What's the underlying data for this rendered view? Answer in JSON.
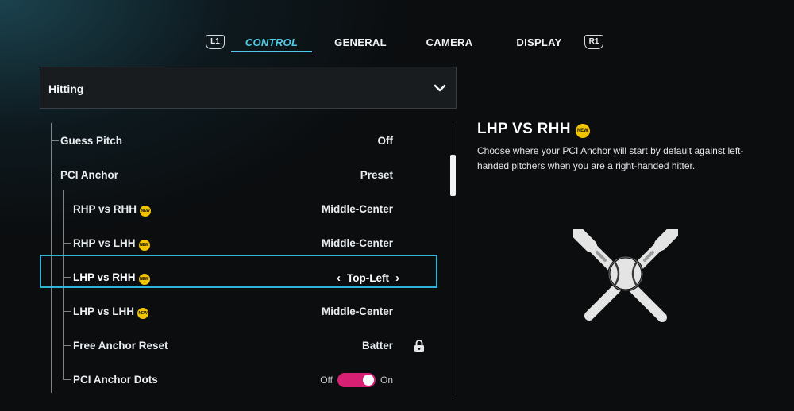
{
  "tabs": {
    "left_bumper": "L1",
    "right_bumper": "R1",
    "items": [
      {
        "label": "CONTROL",
        "active": true
      },
      {
        "label": "GENERAL",
        "active": false
      },
      {
        "label": "CAMERA",
        "active": false
      },
      {
        "label": "DISPLAY",
        "active": false
      }
    ]
  },
  "dropdown": {
    "label": "Hitting",
    "icon": "chevron-down-icon"
  },
  "settings": [
    {
      "name": "Guess Pitch",
      "value": "Off",
      "level": 0
    },
    {
      "name": "PCI Anchor",
      "value": "Preset",
      "level": 0
    },
    {
      "name": "RHP vs RHH",
      "value": "Middle-Center",
      "level": 1,
      "badge": "NEW"
    },
    {
      "name": "RHP vs LHH",
      "value": "Middle-Center",
      "level": 1,
      "badge": "NEW"
    },
    {
      "name": "LHP vs RHH",
      "value": "Top-Left",
      "level": 1,
      "badge": "NEW",
      "selected": true
    },
    {
      "name": "LHP vs LHH",
      "value": "Middle-Center",
      "level": 1,
      "badge": "NEW"
    },
    {
      "name": "Free Anchor Reset",
      "value": "Batter",
      "level": 1,
      "locked": true
    },
    {
      "name": "PCI Anchor Dots",
      "level": 1,
      "toggle": {
        "off_label": "Off",
        "on_label": "On",
        "state": "on"
      }
    }
  ],
  "detail": {
    "title": "LHP VS RHH",
    "badge": "NEW",
    "description": "Choose where your PCI Anchor will start by default against left-handed pitchers when you are a right-handed hitter."
  },
  "colors": {
    "accent": "#4ec9e6",
    "selection_border": "#2fb3d6",
    "badge": "#f2c300",
    "toggle_on": "#d71f74"
  }
}
